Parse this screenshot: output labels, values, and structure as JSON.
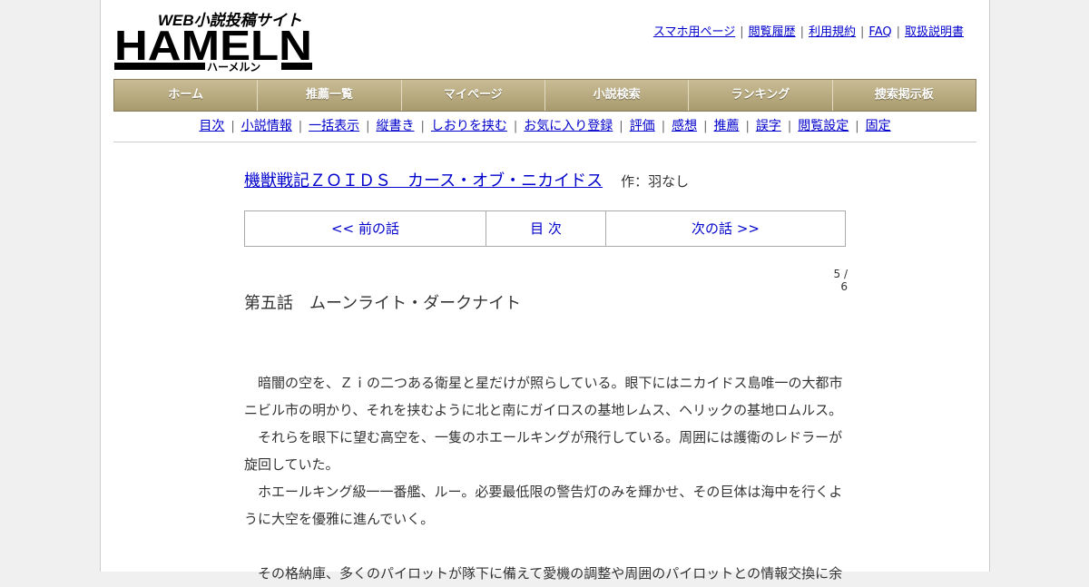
{
  "logo": {
    "tagline": "WEB小説投稿サイト",
    "name": "HAMELN",
    "kana": "ハーメルン"
  },
  "toplinks": [
    "スマホ用ページ",
    "閲覧履歴",
    "利用規約",
    "FAQ",
    "取扱説明書"
  ],
  "mainnav": [
    "ホーム",
    "推薦一覧",
    "マイページ",
    "小説検索",
    "ランキング",
    "捜索掲示板"
  ],
  "subnav": [
    "目次",
    "小説情報",
    "一括表示",
    "縦書き",
    "しおりを挟む",
    "お気に入り登録",
    "評価",
    "感想",
    "推薦",
    "誤字",
    "閲覧設定",
    "固定"
  ],
  "novel": {
    "title": "機獣戦記ＺＯＩＤＳ　カース・オブ・ニカイドス",
    "author": "作：羽なし"
  },
  "pager": {
    "prev": "<< 前の話",
    "toc": "目 次",
    "next": "次の話 >>"
  },
  "page_number": "5 / 6",
  "chapter_title": "第五話　ムーンライト・ダークナイト",
  "paragraphs": [
    "　暗闇の空を、Ｚｉの二つある衛星と星だけが照らしている。眼下にはニカイドス島唯一の大都市ニビル市の明かり、それを挟むように北と南にガイロスの基地レムス、ヘリックの基地ロムルス。",
    "　それらを眼下に望む高空を、一隻のホエールキングが飛行している。周囲には護衛のレドラーが旋回していた。",
    "　ホエールキング級一一番艦、ルー。必要最低限の警告灯のみを輝かせ、その巨体は海中を行くように大空を優雅に進んでいく。",
    "",
    "　その格納庫、多くのパイロットが隊下に備えて愛機の調整や周囲のパイロットとの情報交換に余"
  ]
}
